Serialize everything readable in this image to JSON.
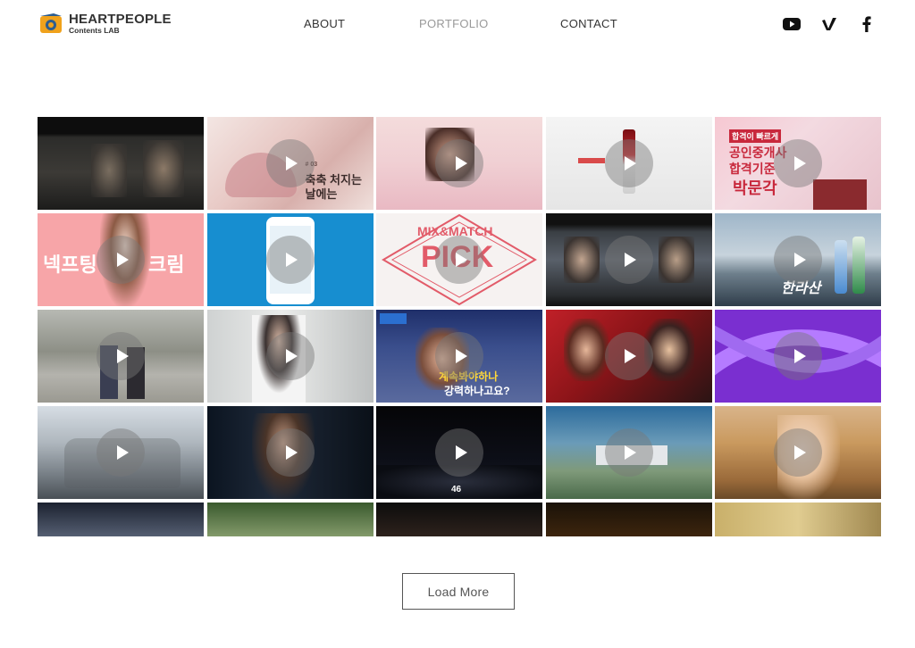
{
  "brand": {
    "title": "HEARTPEOPLE",
    "subtitle": "Contents LAB"
  },
  "nav": {
    "items": [
      {
        "label": "ABOUT"
      },
      {
        "label": "PORTFOLIO"
      },
      {
        "label": "CONTACT"
      }
    ],
    "active": "PORTFOLIO"
  },
  "social": [
    {
      "icon": "youtube-icon"
    },
    {
      "icon": "vimeo-icon"
    },
    {
      "icon": "facebook-icon"
    }
  ],
  "tiles": [
    {
      "texts": []
    },
    {
      "texts": [
        "# 03",
        "축축 처지는",
        "날에는"
      ]
    },
    {
      "texts": []
    },
    {
      "texts": []
    },
    {
      "texts": [
        "합격이 빠르게",
        "공인중개사",
        "합격기준",
        "박문각"
      ]
    },
    {
      "texts": [
        "넥프팅",
        "크림"
      ]
    },
    {
      "texts": []
    },
    {
      "texts": [
        "MIX&MATCH",
        "PICK"
      ]
    },
    {
      "texts": []
    },
    {
      "texts": [
        "한라산"
      ]
    },
    {
      "texts": []
    },
    {
      "texts": []
    },
    {
      "texts": [
        "계속봐야하나",
        "강력하나고요?"
      ]
    },
    {
      "texts": []
    },
    {
      "texts": []
    },
    {
      "texts": []
    },
    {
      "texts": []
    },
    {
      "texts": [
        "46"
      ]
    },
    {
      "texts": []
    },
    {
      "texts": []
    },
    {
      "texts": []
    },
    {
      "texts": []
    },
    {
      "texts": []
    },
    {
      "texts": []
    },
    {
      "texts": []
    }
  ],
  "load_more": "Load More",
  "colors": {
    "accent_logo_orange": "#f0a21c",
    "accent_logo_blue": "#2d5d8f",
    "nav_active": "#999999"
  }
}
